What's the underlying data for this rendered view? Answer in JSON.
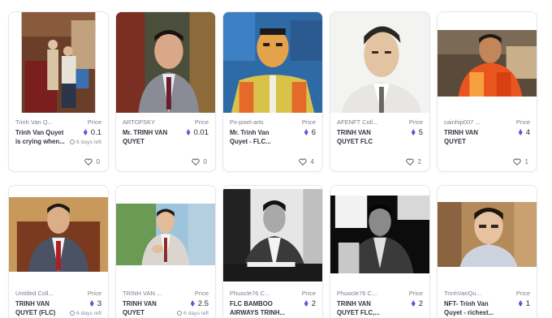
{
  "price_label": "Price",
  "time_left": "6 days left",
  "accent_color": "#6f4bd6",
  "cards": [
    {
      "collection": "Trinh Van Q...",
      "name": "Trinh Van Quyet is crying when...",
      "price": "0.1",
      "time_left": "6 days left",
      "likes": "0"
    },
    {
      "collection": "ARTOFSKY",
      "name": "Mr. TRINH VAN QUYET",
      "price": "0.01",
      "likes": "0"
    },
    {
      "collection": "Px-pixel-arts",
      "name": "Mr. Trinh Van Quyet - FLC...",
      "price": "6",
      "likes": "4"
    },
    {
      "collection": "AFENFT Coll...",
      "name": "TRINH VAN QUYET FLC",
      "price": "5",
      "likes": "2"
    },
    {
      "collection": "cainhip007 ...",
      "name": "TRINH VAN QUYET",
      "price": "4",
      "likes": "1"
    },
    {
      "collection": "Untitled Coll...",
      "name": "TRINH VAN QUYET (FLC)",
      "price": "3",
      "time_left": "6 days left"
    },
    {
      "collection": "TRINH VAN ...",
      "name": "TRINH VAN QUYET",
      "price": "2.5",
      "time_left": "6 days left"
    },
    {
      "collection": "Phuocle76 C...",
      "name": "FLC BAMBOO AIRWAYS TRINH...",
      "price": "2"
    },
    {
      "collection": "Phuocle76 C...",
      "name": "TRINH VAN QUYET FLC,...",
      "price": "2"
    },
    {
      "collection": "TrinhVanQu...",
      "name": "NFT- Trinh Van Quyet - richest...",
      "price": "1"
    }
  ]
}
